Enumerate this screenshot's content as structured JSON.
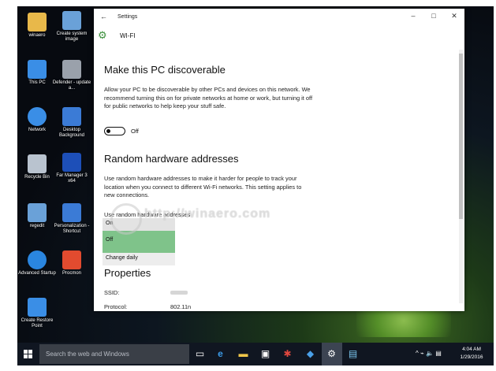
{
  "desktop": {
    "icons": [
      {
        "label": "winaero",
        "icon": "user-folder-icon",
        "color": "#e8b84a"
      },
      {
        "label": "Create system image",
        "icon": "system-image-icon",
        "color": "#6aa1d8"
      },
      {
        "label": "This PC",
        "icon": "computer-icon",
        "color": "#3a8ee6"
      },
      {
        "label": "Defender - update a...",
        "icon": "defender-icon",
        "color": "#9aa1ab"
      },
      {
        "label": "Network",
        "icon": "network-icon",
        "color": "#3a8ee6"
      },
      {
        "label": "Desktop Background",
        "icon": "desktop-background-icon",
        "color": "#3b7bd6"
      },
      {
        "label": "Recycle Bin",
        "icon": "recycle-bin-icon",
        "color": "#b9c3cf"
      },
      {
        "label": "Far Manager 3 x64",
        "icon": "far-manager-icon",
        "color": "#1d4fb8"
      },
      {
        "label": "regedit",
        "icon": "regedit-icon",
        "color": "#6aa1d8"
      },
      {
        "label": "Personalization - Shortcut",
        "icon": "personalization-icon",
        "color": "#3b7bd6"
      },
      {
        "label": "Advanced Startup",
        "icon": "advanced-startup-icon",
        "color": "#2a86e0"
      },
      {
        "label": "Procmon",
        "icon": "procmon-icon",
        "color": "#e24b2f"
      },
      {
        "label": "Create Restore Point",
        "icon": "restore-point-icon",
        "color": "#3a8ee6"
      }
    ]
  },
  "window": {
    "title": "Settings",
    "page_name": "WI-FI",
    "back_glyph": "←",
    "minimize_glyph": "–",
    "maximize_glyph": "□",
    "close_glyph": "✕",
    "gear_glyph": "⚙",
    "discoverable": {
      "heading": "Make this PC discoverable",
      "description": "Allow your PC to be discoverable by other PCs and devices on this network. We recommend turning this on for private networks at home or work, but turning it off for public networks to help keep your stuff safe.",
      "toggle_state": "Off"
    },
    "random_hw": {
      "heading": "Random hardware addresses",
      "description": "Use random hardware addresses to make it harder for people to track your location when you connect to different Wi-Fi networks. This setting applies to new connections.",
      "option_label": "Use random hardware addresses",
      "dropdown_options": [
        "On",
        "Off",
        "Change daily"
      ],
      "selected": "Off"
    },
    "properties": {
      "heading": "Properties",
      "ssid_label": "SSID:",
      "protocol_label": "Protocol:",
      "protocol_value": "802.11n"
    }
  },
  "watermark": {
    "text": "http://winaero.com"
  },
  "taskbar": {
    "search_placeholder": "Search the web and Windows",
    "time": "4:04 AM",
    "date": "1/29/2016",
    "tray_glyphs": "^ ⌁ 🔈 ▤"
  }
}
